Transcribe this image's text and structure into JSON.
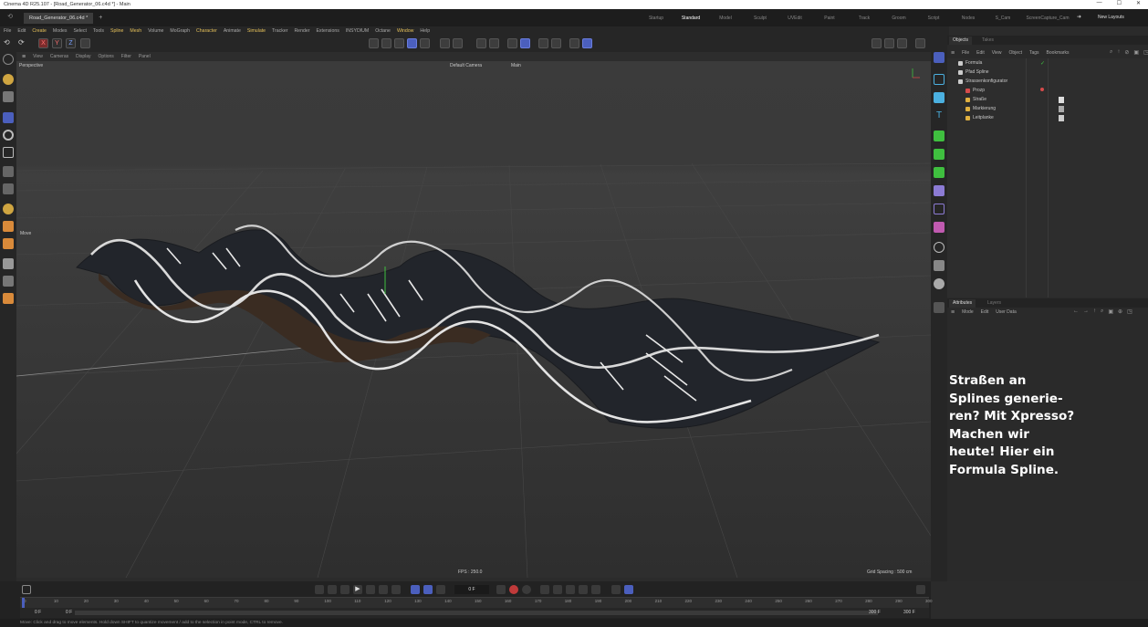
{
  "window": {
    "title": "Cinema 4D R25.107 - [Road_Generator_06.c4d *] - Main",
    "controls": [
      "—",
      "☐",
      "✕"
    ]
  },
  "tabs": {
    "document": "Road_Generator_06.c4d *",
    "new_tab": "+",
    "layouts": [
      "Startup",
      "Standard",
      "Model",
      "Sculpt",
      "UVEdit",
      "Paint",
      "Track",
      "Groom",
      "Script",
      "Nodes",
      "S_Cam",
      "ScreenCapture_Cam"
    ],
    "active_layout": "Standard",
    "new_layouts": "New Layouts"
  },
  "menu": [
    "File",
    "Edit",
    "Create",
    "Modes",
    "Select",
    "Tools",
    "Spline",
    "Mesh",
    "Volume",
    "MoGraph",
    "Character",
    "Animate",
    "Simulate",
    "Tracker",
    "Render",
    "Extensions",
    "INSYDIUM",
    "Octane",
    "Window",
    "Help"
  ],
  "axis_locks": [
    "X",
    "Y",
    "Z"
  ],
  "viewport": {
    "menu": [
      "View",
      "Cameras",
      "Display",
      "Options",
      "Filter",
      "Panel"
    ],
    "label": "Perspective",
    "camera": "Default Camera",
    "take": "Main",
    "move_label": "Move",
    "fps": "FPS : 250.0",
    "grid_spacing": "Grid Spacing : 500 cm",
    "colors": {
      "background": "#3a3a3a",
      "road": "#22252b",
      "rail": "#d9d9d9",
      "marking": "#e8e8e8"
    }
  },
  "overlay_text": [
    "Straßen an",
    "Splines generie-",
    "ren? Mit Xpresso?",
    "Machen wir",
    "heute! Hier ein",
    "Formula Spline."
  ],
  "objects_panel": {
    "tabs": [
      "Objects",
      "Takes"
    ],
    "menu": [
      "File",
      "Edit",
      "View",
      "Object",
      "Tags",
      "Bookmarks"
    ],
    "items": [
      {
        "name": "Formula",
        "color": "#cccccc"
      },
      {
        "name": "Pfad Spline",
        "color": "#cccccc"
      },
      {
        "name": "Strassenkonfigurator",
        "color": "#cccccc"
      },
      {
        "name": "Prozp",
        "color": "#d64b4b"
      },
      {
        "name": "Straße",
        "color": "#e0b040"
      },
      {
        "name": "Markierung",
        "color": "#e0b040"
      },
      {
        "name": "Leitplanke",
        "color": "#e0b040"
      }
    ]
  },
  "attributes_panel": {
    "tabs": [
      "Attributes",
      "Layers"
    ],
    "menu": [
      "Mode",
      "Edit",
      "User Data"
    ]
  },
  "timeline": {
    "current_frame": "0 F",
    "start_frame": "0 F",
    "start_frame2": "0 F",
    "end_frame": "300 F",
    "end_frame2": "300 F",
    "ruler_ticks": [
      "0",
      "10",
      "20",
      "30",
      "40",
      "50",
      "60",
      "70",
      "80",
      "90",
      "100",
      "110",
      "120",
      "130",
      "140",
      "150",
      "160",
      "170",
      "180",
      "190",
      "200",
      "210",
      "220",
      "230",
      "240",
      "250",
      "260",
      "270",
      "280",
      "290",
      "300"
    ]
  },
  "status": "Move: Click and drag to move elements. Hold down SHIFT to quantize movement / add to the selection in point mode, CTRL to remove."
}
